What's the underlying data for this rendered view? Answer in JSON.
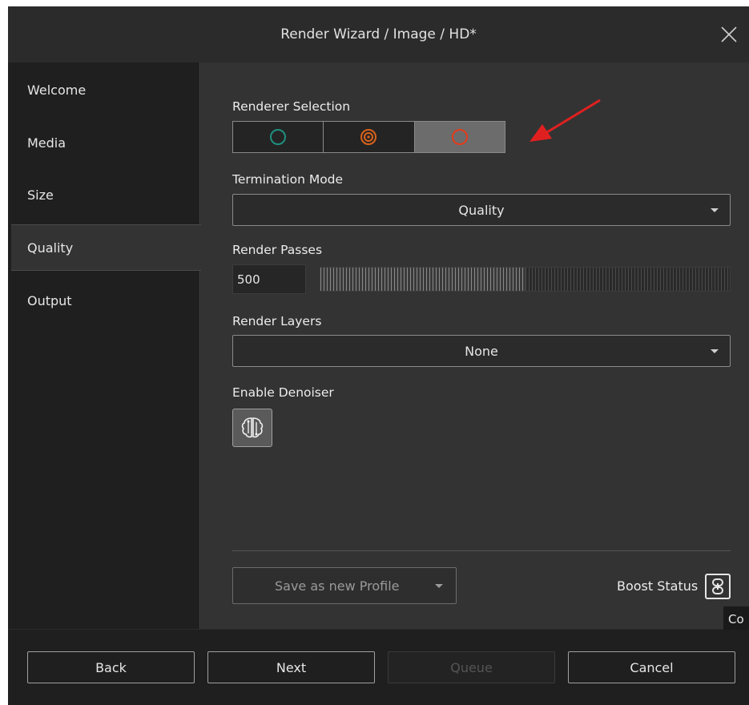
{
  "window": {
    "title": "Render Wizard / Image / HD*"
  },
  "sidebar": {
    "items": [
      {
        "label": "Welcome"
      },
      {
        "label": "Media"
      },
      {
        "label": "Size"
      },
      {
        "label": "Quality",
        "active": true
      },
      {
        "label": "Output"
      }
    ]
  },
  "renderer": {
    "label": "Renderer Selection",
    "options": [
      {
        "icon": "teal-circle-icon",
        "color": "#1f8f7f"
      },
      {
        "icon": "orange-target-icon",
        "color": "#d9621c"
      },
      {
        "icon": "red-compass-icon",
        "color": "#e43a1a",
        "selected": true
      }
    ]
  },
  "termination": {
    "label": "Termination Mode",
    "value": "Quality"
  },
  "passes": {
    "label": "Render Passes",
    "value": "500",
    "slider_fraction": 0.5
  },
  "layers": {
    "label": "Render Layers",
    "value": "None"
  },
  "denoiser": {
    "label": "Enable Denoiser",
    "icon": "denoiser-brain-icon"
  },
  "profile": {
    "label": "Save as new Profile"
  },
  "boost": {
    "label": "Boost Status",
    "icon": "boost-chain-icon"
  },
  "tooltip": {
    "text": "Co"
  },
  "footer": {
    "back": "Back",
    "next": "Next",
    "queue": "Queue",
    "cancel": "Cancel"
  },
  "colors": {
    "accent_arrow": "#e02020",
    "background": "#333333",
    "sidebar": "#1f1f1f"
  }
}
